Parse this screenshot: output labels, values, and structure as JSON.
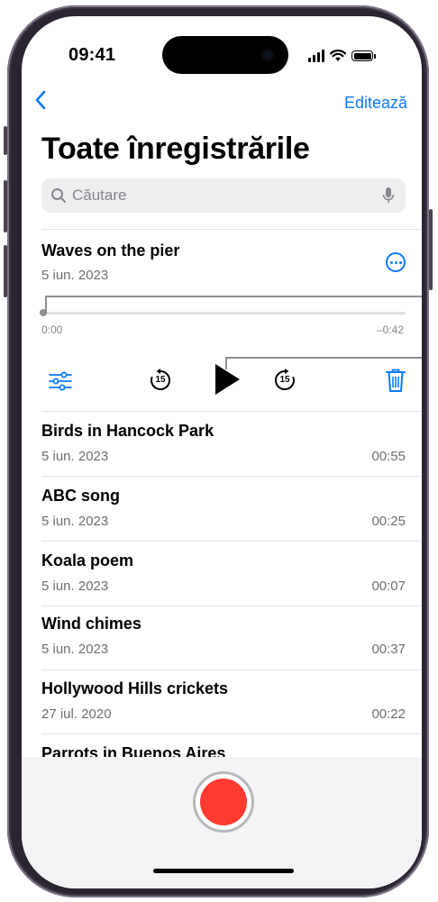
{
  "status_bar": {
    "time": "09:41"
  },
  "nav": {
    "back_icon": "chevron-left-icon",
    "edit_label": "Editează"
  },
  "page": {
    "title": "Toate înregistrările"
  },
  "search": {
    "placeholder": "Căutare",
    "icon": "search-icon",
    "mic_icon": "microphone-icon"
  },
  "current_recording": {
    "name": "Waves on the pier",
    "date": "5 iun. 2023",
    "elapsed": "0:00",
    "remaining": "–0:42",
    "progress": 0.0
  },
  "player_controls": {
    "options_icon": "sliders-icon",
    "skip_back_label": "15",
    "play_icon": "play-icon",
    "skip_forward_label": "15",
    "delete_icon": "trash-icon"
  },
  "recordings": [
    {
      "name": "Birds in Hancock Park",
      "date": "5 iun. 2023",
      "duration": "00:55"
    },
    {
      "name": "ABC song",
      "date": "5 iun. 2023",
      "duration": "00:25"
    },
    {
      "name": "Koala poem",
      "date": "5 iun. 2023",
      "duration": "00:07"
    },
    {
      "name": "Wind chimes",
      "date": "5 iun. 2023",
      "duration": "00:37"
    },
    {
      "name": "Hollywood Hills crickets",
      "date": "27 iul. 2020",
      "duration": "00:22"
    },
    {
      "name": "Parrots in Buenos Aires",
      "date": "",
      "duration": ""
    }
  ],
  "colors": {
    "accent": "#0a7aff",
    "record": "#ff3b30",
    "frame": "#2a2530"
  }
}
